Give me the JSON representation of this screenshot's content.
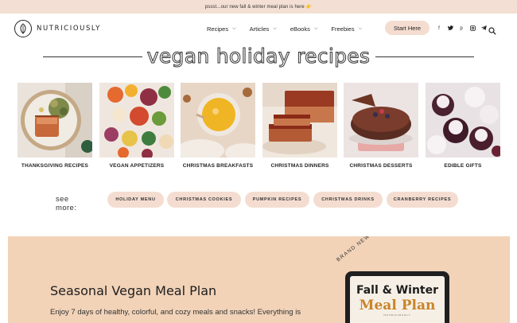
{
  "promo": {
    "text": "pssst...our new fall & winter meal plan is here 👉"
  },
  "header": {
    "logo_text": "NUTRICIOUSLY",
    "nav": [
      {
        "label": "Recipes",
        "has_dropdown": true
      },
      {
        "label": "Articles",
        "has_dropdown": true
      },
      {
        "label": "eBooks",
        "has_dropdown": true
      },
      {
        "label": "Freebies",
        "has_dropdown": true
      }
    ],
    "cta_label": "Start Here",
    "social": [
      "facebook-icon",
      "twitter-icon",
      "pinterest-icon",
      "instagram-icon",
      "telegram-icon"
    ],
    "search_icon": "search-icon"
  },
  "page_title": "vegan holiday recipes",
  "categories": [
    {
      "label": "THANKSGIVING RECIPES"
    },
    {
      "label": "VEGAN APPETIZERS"
    },
    {
      "label": "CHRISTMAS BREAKFASTS"
    },
    {
      "label": "CHRISTMAS DINNERS"
    },
    {
      "label": "CHRISTMAS DESSERTS"
    },
    {
      "label": "EDIBLE GIFTS"
    }
  ],
  "see_more": {
    "label": "see more:",
    "pills": [
      "HOLIDAY MENU",
      "CHRISTMAS COOKIES",
      "PUMPKIN RECIPES",
      "CHRISTMAS DRINKS",
      "CRANBERRY RECIPES"
    ]
  },
  "meal_plan": {
    "title": "Seasonal Vegan Meal Plan",
    "description": "Enjoy 7 days of healthy, colorful, and cozy meals and snacks! Everything is",
    "badge": "BRAND NEW!",
    "tablet_line1": "Fall & Winter",
    "tablet_line2": "Meal Plan",
    "tablet_line3": "NUTRICIOUSLY"
  },
  "colors": {
    "promo_bg": "#f3dfd3",
    "pill_bg": "#f4ddd0",
    "meal_plan_bg": "#f2d3b8",
    "accent_gold": "#c88428"
  }
}
